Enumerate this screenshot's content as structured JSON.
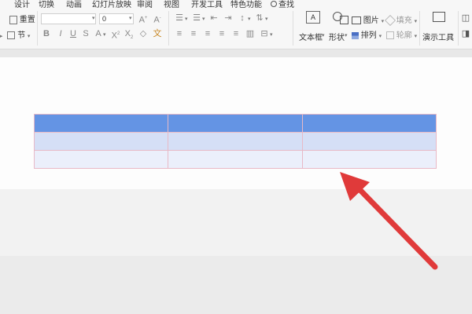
{
  "ribbon_tabs": [
    "设计",
    "切换",
    "动画",
    "幻灯片放映",
    "审阅",
    "视图",
    "开发工具",
    "特色功能",
    "查找"
  ],
  "home": {
    "reset": "重置",
    "section": "节",
    "font_name": "",
    "font_size": "0",
    "text_box": "文本框",
    "shape": "形状",
    "picture": "图片",
    "fill": "填充",
    "arrange": "排列",
    "outline": "轮廓",
    "present_tools": "演示工具"
  },
  "colors": {
    "header_row": "#6494e4",
    "band_1": "#d5dff6",
    "band_2": "#ebeffb",
    "cell_border": "#e8b9c6",
    "arrow": "#e03a3a"
  },
  "table": {
    "rows": [
      [
        "",
        "",
        ""
      ],
      [
        "",
        "",
        ""
      ],
      [
        "",
        "",
        ""
      ]
    ]
  }
}
